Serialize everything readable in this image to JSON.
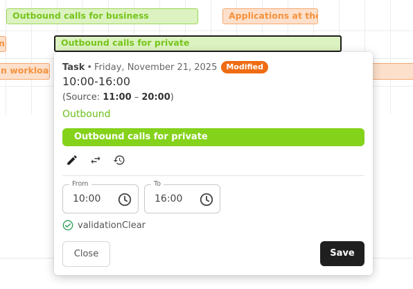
{
  "timeline": {
    "bars": [
      {
        "label": "Outbound calls for business",
        "color": "green"
      },
      {
        "label": "Applications at the e",
        "color": "orange"
      },
      {
        "label": "Outbound calls for private",
        "color": "green",
        "selected": true
      },
      {
        "label": "n",
        "color": "orange"
      },
      {
        "label": "n workload",
        "color": "orange"
      }
    ]
  },
  "popover": {
    "task_label": "Task",
    "separator": "•",
    "date": "Friday, November 21, 2025",
    "badge": "Modified",
    "time_range": "10:00-16:00",
    "source_prefix": "(Source: ",
    "source_start": "11:00",
    "source_dash": " – ",
    "source_end": "20:00",
    "source_suffix": ")",
    "direction": "Outbound",
    "activity": "Outbound calls for private",
    "from_label": "From",
    "from_value": "10:00",
    "to_label": "To",
    "to_value": "16:00",
    "validation": "validationClear",
    "close_label": "Close",
    "save_label": "Save"
  },
  "colors": {
    "badge": "#ef6c13",
    "activity_chip": "#84d21a",
    "direction_text": "#6cc11c",
    "save_button": "#1f1f1f",
    "valid_icon": "#2e9c5a"
  },
  "icons": [
    "edit-icon",
    "swap-icon",
    "history-icon",
    "clock-icon",
    "check-circle-icon"
  ]
}
